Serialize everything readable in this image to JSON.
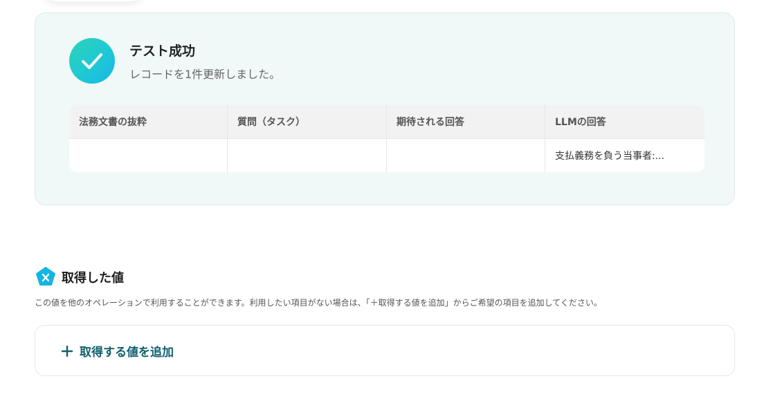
{
  "test_result": {
    "title": "テスト成功",
    "subtitle": "レコードを1件更新しました。",
    "icon": "checkmark-icon",
    "accent": "#1ec9d4"
  },
  "table": {
    "headers": [
      "法務文書の抜粋",
      "質問（タスク）",
      "期待される回答",
      "LLMの回答"
    ],
    "rows": [
      [
        "",
        "",
        "",
        "支払義務を負う当事者:..."
      ]
    ]
  },
  "acquired_values": {
    "icon": "x-pentagon-icon",
    "title": "取得した値",
    "description": "この値を他のオペレーションで利用することができます。利用したい項目がない場合は、「＋取得する値を追加」からご希望の項目を追加してください。",
    "add_button_label": "取得する値を追加",
    "button_color": "#10606e"
  }
}
